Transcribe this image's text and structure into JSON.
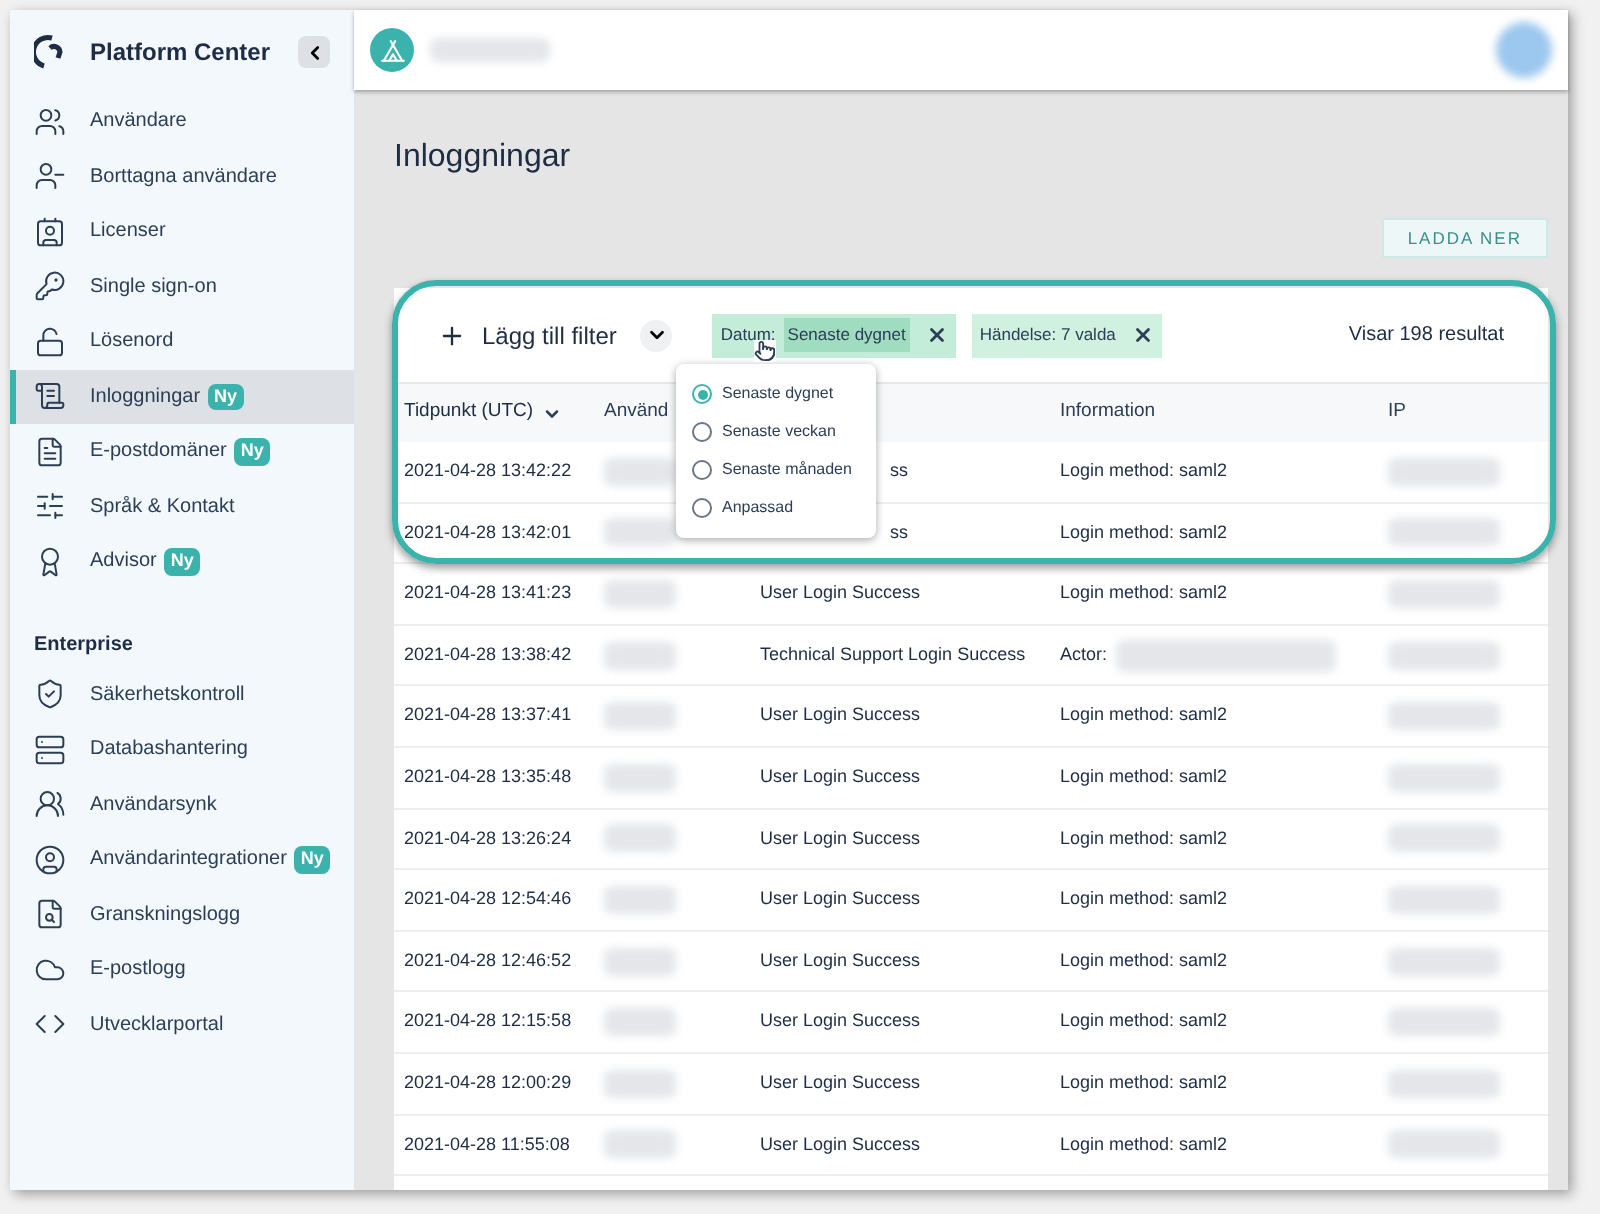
{
  "sidebar": {
    "brand": "Platform Center",
    "items": [
      {
        "label": "Användare",
        "selected": false
      },
      {
        "label": "Borttagna användare",
        "selected": false
      },
      {
        "label": "Licenser",
        "selected": false
      },
      {
        "label": "Single sign-on",
        "selected": false
      },
      {
        "label": "Lösenord",
        "selected": false
      },
      {
        "label": "Inloggningar",
        "badge": "Ny",
        "selected": true
      },
      {
        "label": "E-postdomäner",
        "badge": "Ny",
        "selected": false
      },
      {
        "label": "Språk & Kontakt",
        "selected": false
      },
      {
        "label": "Advisor",
        "badge": "Ny",
        "selected": false
      }
    ],
    "section": {
      "title": "Enterprise",
      "items": [
        {
          "label": "Säkerhetskontroll",
          "selected": false
        },
        {
          "label": "Databashantering",
          "selected": false
        },
        {
          "label": "Användarsynk",
          "selected": false
        },
        {
          "label": "Användarintegrationer",
          "badge": "Ny",
          "selected": false
        },
        {
          "label": "Granskningslogg",
          "selected": false
        },
        {
          "label": "E-postlogg",
          "selected": false
        },
        {
          "label": "Utvecklarportal",
          "selected": false
        }
      ]
    }
  },
  "page": {
    "title": "Inloggningar",
    "download_button": "LADDA NER"
  },
  "filters": {
    "add_filter": "Lägg till filter",
    "chips": [
      {
        "label": "Datum:",
        "value": "Senaste dygnet",
        "open": true
      },
      {
        "label": "Händelse: 7 valda",
        "open": false
      }
    ],
    "result_count": "Visar 198 resultat",
    "dropdown": {
      "options": [
        {
          "label": "Senaste dygnet",
          "selected": true
        },
        {
          "label": "Senaste veckan",
          "selected": false
        },
        {
          "label": "Senaste månaden",
          "selected": false
        },
        {
          "label": "Anpassad",
          "selected": false
        }
      ]
    }
  },
  "table": {
    "columns": [
      {
        "label": "Tidpunkt (UTC)",
        "sorted": true
      },
      {
        "label": "Använd",
        "sorted": false
      },
      {
        "label": "Information",
        "sorted": false
      },
      {
        "label": "IP",
        "sorted": false
      }
    ],
    "rows": [
      {
        "time": "2021-04-28 13:42:22",
        "event": "ss",
        "covered": true,
        "info": "Login method: saml2",
        "info_redacted": false
      },
      {
        "time": "2021-04-28 13:42:01",
        "event": "ss",
        "covered": true,
        "info": "Login method: saml2",
        "info_redacted": false
      },
      {
        "time": "2021-04-28 13:41:23",
        "event": "User Login Success",
        "covered": false,
        "info": "Login method: saml2",
        "info_redacted": false
      },
      {
        "time": "2021-04-28 13:38:42",
        "event": "Technical Support Login Success",
        "covered": false,
        "info": "Actor:",
        "info_redacted": true
      },
      {
        "time": "2021-04-28 13:37:41",
        "event": "User Login Success",
        "covered": false,
        "info": "Login method: saml2",
        "info_redacted": false
      },
      {
        "time": "2021-04-28 13:35:48",
        "event": "User Login Success",
        "covered": false,
        "info": "Login method: saml2",
        "info_redacted": false
      },
      {
        "time": "2021-04-28 13:26:24",
        "event": "User Login Success",
        "covered": false,
        "info": "Login method: saml2",
        "info_redacted": false
      },
      {
        "time": "2021-04-28 12:54:46",
        "event": "User Login Success",
        "covered": false,
        "info": "Login method: saml2",
        "info_redacted": false
      },
      {
        "time": "2021-04-28 12:46:52",
        "event": "User Login Success",
        "covered": false,
        "info": "Login method: saml2",
        "info_redacted": false
      },
      {
        "time": "2021-04-28 12:15:58",
        "event": "User Login Success",
        "covered": false,
        "info": "Login method: saml2",
        "info_redacted": false
      },
      {
        "time": "2021-04-28 12:00:29",
        "event": "User Login Success",
        "covered": false,
        "info": "Login method: saml2",
        "info_redacted": false
      },
      {
        "time": "2021-04-28 11:55:08",
        "event": "User Login Success",
        "covered": false,
        "info": "Login method: saml2",
        "info_redacted": false
      }
    ]
  }
}
